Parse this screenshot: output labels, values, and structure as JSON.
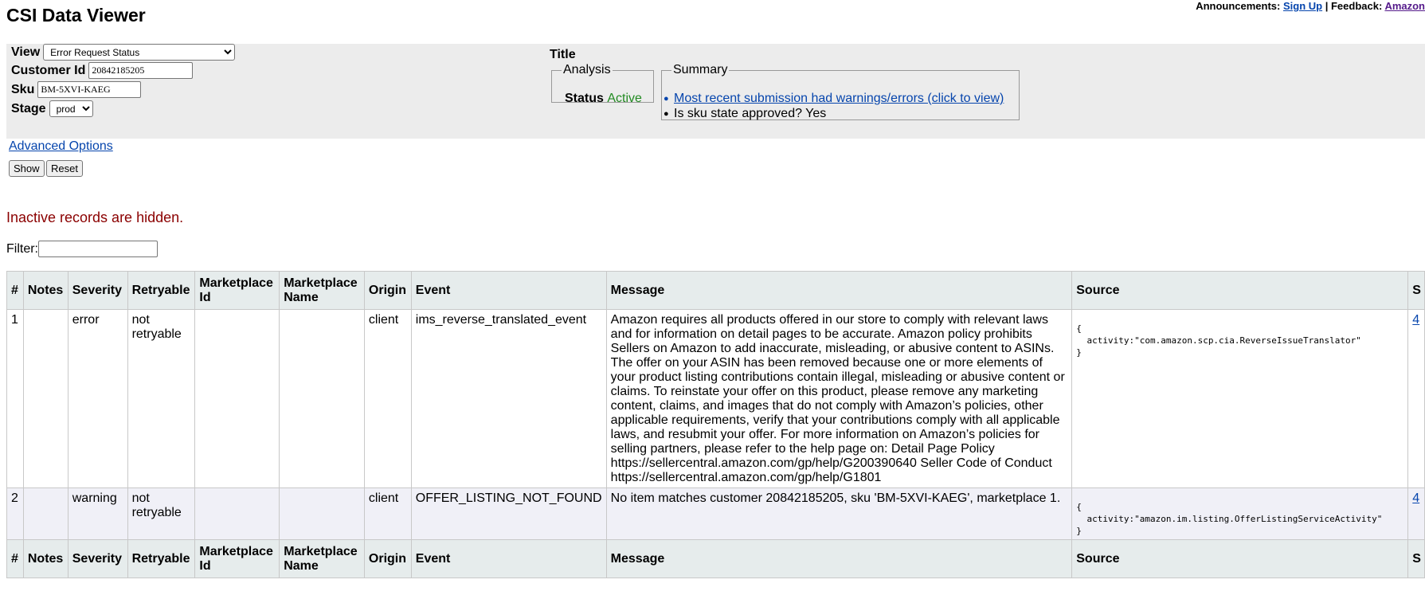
{
  "app_title": "CSI Data Viewer",
  "announcements": {
    "label": "Announcements:",
    "signup_link": "Sign Up",
    "separator": "|",
    "feedback_label": "Feedback:",
    "feedback_link": "Amazon"
  },
  "form": {
    "view_label": "View",
    "view_value": "Error Request Status",
    "customer_label": "Customer Id",
    "customer_value": "20842185205",
    "sku_label": "Sku",
    "sku_value": "BM-5XVI-KAEG",
    "stage_label": "Stage",
    "stage_value": "prod",
    "advanced_link": "Advanced Options",
    "show_button": "Show",
    "reset_button": "Reset"
  },
  "title_section": {
    "title_label": "Title",
    "analysis_legend": "Analysis",
    "status_label": "Status",
    "status_value": "Active",
    "status_color": "#228b22",
    "summary_legend": "Summary",
    "summary_link": "Most recent submission had warnings/errors (click to view)",
    "summary_text": "Is sku state approved? Yes"
  },
  "inactive_notice": "Inactive records are hidden.",
  "filter": {
    "label": "Filter:",
    "value": ""
  },
  "table": {
    "headers": {
      "num": "#",
      "notes": "Notes",
      "severity": "Severity",
      "retryable": "Retryable",
      "mkt_id": "Marketplace Id",
      "mkt_name": "Marketplace Name",
      "origin": "Origin",
      "event": "Event",
      "message": "Message",
      "source": "Source",
      "extra": "S"
    },
    "rows": [
      {
        "num": "1",
        "notes": "",
        "severity": "error",
        "retryable": "not retryable",
        "mkt_id": "",
        "mkt_name": "",
        "origin": "client",
        "event": "ims_reverse_translated_event",
        "message": "Amazon requires all products offered in our store to comply with relevant laws and for information on detail pages to be accurate. Amazon policy prohibits Sellers on Amazon to add inaccurate, misleading, or abusive content to ASINs. The offer on your ASIN has been removed because one or more elements of your product listing contributions contain illegal, misleading or abusive content or claims. To reinstate your offer on this product, please remove any marketing content, claims, and images that do not comply with Amazon’s policies, other applicable requirements, verify that your contributions comply with all applicable laws, and resubmit your offer. For more information on Amazon’s policies for selling partners, please refer to the help page on: Detail Page Policy https://sellercentral.amazon.com/gp/help/G200390640 Seller Code of Conduct https://sellercentral.amazon.com/gp/help/G1801",
        "source": "{\n  activity:\"com.amazon.scp.cia.ReverseIssueTranslator\"\n}",
        "extra": "4"
      },
      {
        "num": "2",
        "notes": "",
        "severity": "warning",
        "retryable": "not retryable",
        "mkt_id": "",
        "mkt_name": "",
        "origin": "client",
        "event": "OFFER_LISTING_NOT_FOUND",
        "message": "No item matches customer 20842185205, sku 'BM-5XVI-KAEG', marketplace 1.",
        "source": "{\n  activity:\"amazon.im.listing.OfferListingServiceActivity\"\n}",
        "extra": "4"
      }
    ]
  }
}
